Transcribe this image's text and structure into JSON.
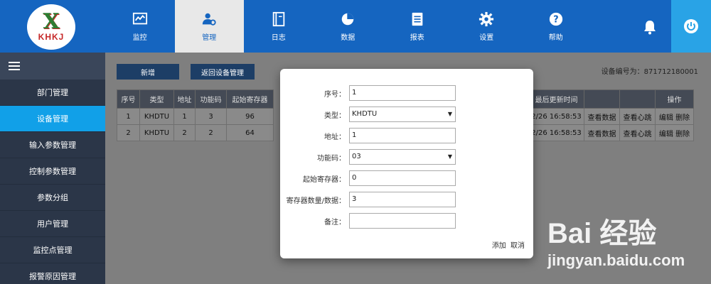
{
  "app": {
    "logo_text": "KHKJ",
    "logo_mark": "X"
  },
  "nav": [
    {
      "label": "监控",
      "icon": "chart-icon"
    },
    {
      "label": "管理",
      "icon": "user-gear-icon"
    },
    {
      "label": "日志",
      "icon": "notebook-icon"
    },
    {
      "label": "数据",
      "icon": "pie-chart-icon"
    },
    {
      "label": "报表",
      "icon": "document-icon"
    },
    {
      "label": "设置",
      "icon": "gear-icon"
    },
    {
      "label": "帮助",
      "icon": "help-icon"
    }
  ],
  "sidebar": {
    "items": [
      {
        "label": "部门管理"
      },
      {
        "label": "设备管理"
      },
      {
        "label": "输入参数管理"
      },
      {
        "label": "控制参数管理"
      },
      {
        "label": "参数分组"
      },
      {
        "label": "用户管理"
      },
      {
        "label": "监控点管理"
      },
      {
        "label": "报警原因管理"
      }
    ]
  },
  "toolbar": {
    "add_label": "新增",
    "back_label": "返回设备管理",
    "device_no": "设备编号为：871712180001"
  },
  "table": {
    "headers": [
      "序号",
      "类型",
      "地址",
      "功能码",
      "起始寄存器"
    ],
    "rows": [
      [
        "1",
        "KHDTU",
        "1",
        "3",
        "96"
      ],
      [
        "2",
        "KHDTU",
        "2",
        "2",
        "64"
      ]
    ],
    "right_headers": [
      "最后更新时间",
      "",
      "",
      "操作"
    ],
    "right_rows": [
      [
        "2/26 16:58:53",
        "查看数据",
        "查看心跳",
        "编辑 删除"
      ],
      [
        "2/26 16:58:53",
        "查看数据",
        "查看心跳",
        "编辑 删除"
      ]
    ]
  },
  "modal": {
    "fields": [
      {
        "label": "序号：",
        "value": "1",
        "kind": "input"
      },
      {
        "label": "类型：",
        "value": "KHDTU",
        "kind": "select"
      },
      {
        "label": "地址：",
        "value": "1",
        "kind": "input"
      },
      {
        "label": "功能码：",
        "value": "03",
        "kind": "select"
      },
      {
        "label": "起始寄存器：",
        "value": "0",
        "kind": "input"
      },
      {
        "label": "寄存器数量/数据：",
        "value": "3",
        "kind": "input"
      },
      {
        "label": "备注：",
        "value": "",
        "kind": "input"
      }
    ],
    "add_label": "添加",
    "cancel_label": "取消"
  },
  "watermark": {
    "main": "Bai 经验",
    "url": "jingyan.baidu.com"
  },
  "colors": {
    "header": "#1565c0",
    "active_side": "#11a0e8",
    "sidebar": "#2b3648",
    "power": "#29a3e6"
  }
}
